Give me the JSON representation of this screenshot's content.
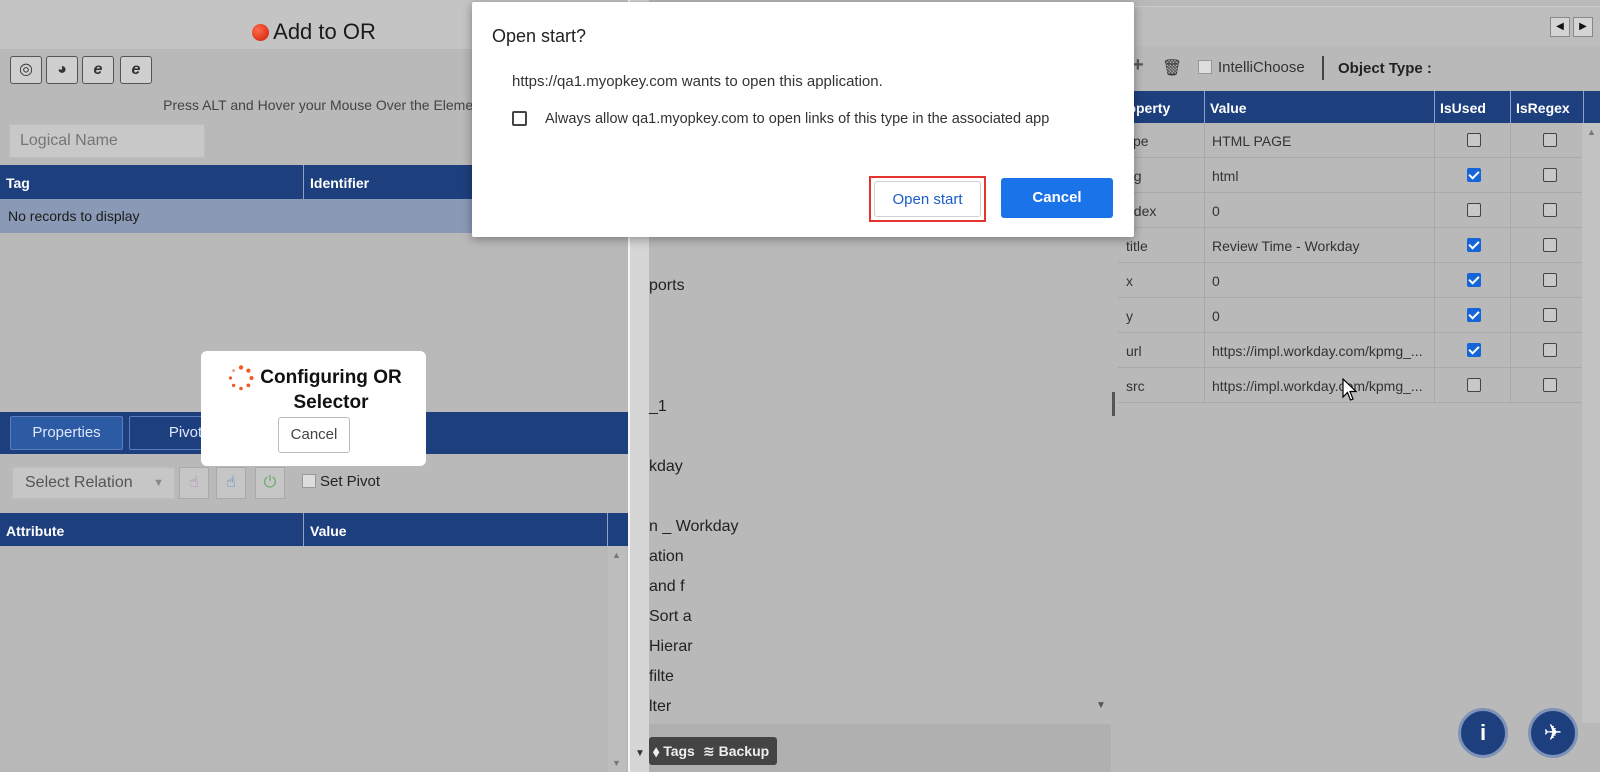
{
  "left_panel": {
    "title": "Add to OR",
    "browser_buttons": [
      {
        "icon": "chrome-icon",
        "glyph": "◎"
      },
      {
        "icon": "firefox-icon",
        "glyph": "◕"
      },
      {
        "icon": "ie-icon",
        "glyph": "e"
      },
      {
        "icon": "edge-icon",
        "glyph": "e"
      }
    ],
    "hint": "Press ALT and Hover your Mouse Over the Element",
    "logical_name_placeholder": "Logical Name",
    "tag_grid": {
      "col_tag": "Tag",
      "col_identifier": "Identifier",
      "empty_text": "No records to display"
    },
    "tabs": {
      "properties": "Properties",
      "pivot": "Pivot"
    },
    "select_relation": "Select Relation",
    "set_pivot": "Set Pivot",
    "attr_grid": {
      "col_attribute": "Attribute",
      "col_value": "Value"
    }
  },
  "loading": {
    "text": "Configuring OR Selector",
    "cancel": "Cancel"
  },
  "middle_panel": {
    "tree_items": [
      "ports",
      "_1",
      "kday",
      "n _ Workday",
      "ation",
      "and f",
      "Sort a",
      "Hierar",
      "filte",
      "lter"
    ],
    "buttons": {
      "tags": "Tags",
      "backup": "Backup"
    }
  },
  "right_panel": {
    "intellichoose": "IntelliChoose",
    "object_type_label": "Object Type :",
    "columns": {
      "property": "roperty",
      "value": "Value",
      "isused": "IsUsed",
      "isregex": "IsRegex"
    },
    "rows": [
      {
        "property": "ype",
        "value": "HTML PAGE",
        "isused": false,
        "isregex": false
      },
      {
        "property": "ag",
        "value": "html",
        "isused": true,
        "isregex": false
      },
      {
        "property": "ndex",
        "value": "0",
        "isused": false,
        "isregex": false
      },
      {
        "property": "title",
        "value": "Review Time - Workday",
        "isused": true,
        "isregex": false
      },
      {
        "property": "x",
        "value": "0",
        "isused": true,
        "isregex": false
      },
      {
        "property": "y",
        "value": "0",
        "isused": true,
        "isregex": false
      },
      {
        "property": "url",
        "value": "https://impl.workday.com/kpmg_...",
        "isused": true,
        "isregex": false
      },
      {
        "property": "src",
        "value": "https://impl.workday.com/kpmg_...",
        "isused": false,
        "isregex": false
      }
    ]
  },
  "dialog": {
    "title": "Open start?",
    "message": "https://qa1.myopkey.com wants to open this application.",
    "always_allow": "Always allow qa1.myopkey.com to open links of this type in the associated app",
    "open_button": "Open start",
    "cancel_button": "Cancel"
  }
}
